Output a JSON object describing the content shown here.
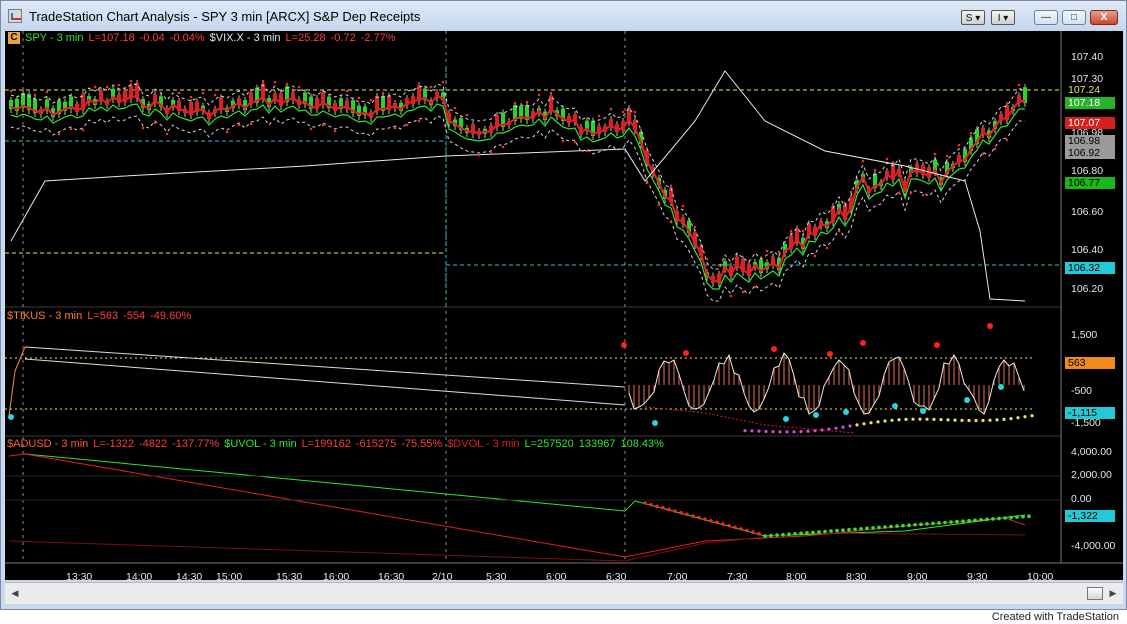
{
  "window": {
    "title": "TradeStation Chart Analysis - SPY 3 min [ARCX] S&P Dep Receipts"
  },
  "toolbar": {
    "s_button": "S",
    "i_button": "I"
  },
  "caption": {
    "minimize": "—",
    "maximize": "□",
    "close": "X"
  },
  "panes": {
    "price": {
      "badge": "C",
      "legend": [
        {
          "text": "SPY - 3 min",
          "color": "#2ee62e"
        },
        {
          "text": "L=107.18",
          "color": "#ff3b3b"
        },
        {
          "text": "-0.04",
          "color": "#ff3b3b"
        },
        {
          "text": "-0.04%",
          "color": "#ff3b3b"
        },
        {
          "text": "$VIX.X - 3 min",
          "color": "#e6e6e6"
        },
        {
          "text": "L=25.28",
          "color": "#ff3b3b"
        },
        {
          "text": "-0.72",
          "color": "#ff3b3b"
        },
        {
          "text": "-2.77%",
          "color": "#ff3b3b"
        }
      ],
      "axis": [
        "107.40",
        "107.30",
        "107.24",
        "107.18",
        "107.07",
        "106.98",
        "106.92",
        "106.80",
        "106.77",
        "106.60",
        "106.40",
        "106.32",
        "106.20"
      ],
      "tags": {
        "t10724": {
          "text": "107.24",
          "bg": "#000000",
          "fg": "#f0e44c"
        },
        "t10718": {
          "text": "107.18",
          "bg": "#27b327",
          "fg": "#ffffff"
        },
        "t10707": {
          "text": "107.07",
          "bg": "#d81f1f",
          "fg": "#ffffff"
        },
        "t10698": {
          "text": "106.98",
          "bg": "#9a9a9a",
          "fg": "#000000"
        },
        "t10692": {
          "text": "106.92",
          "bg": "#9a9a9a",
          "fg": "#000000"
        },
        "t10677": {
          "text": "106.77",
          "bg": "#18b818",
          "fg": "#000000"
        },
        "t10632": {
          "text": "106.32",
          "bg": "#24c9d6",
          "fg": "#000000"
        }
      }
    },
    "tikus": {
      "legend": [
        {
          "text": "$TIKUS - 3 min",
          "color": "#ff7b2a"
        },
        {
          "text": "L=563",
          "color": "#ff3b3b"
        },
        {
          "text": "-554",
          "color": "#ff3b3b"
        },
        {
          "text": "-49.60%",
          "color": "#ff3b3b"
        }
      ],
      "axis": [
        "1,500",
        "-500",
        "-1,500"
      ],
      "tags": {
        "t563": {
          "text": "563",
          "bg": "#f08a1c",
          "fg": "#000000"
        },
        "t1115": {
          "text": "-1,115",
          "bg": "#24c9d6",
          "fg": "#000000"
        }
      }
    },
    "adusd": {
      "legend": [
        {
          "text": "$ADUSD - 3 min",
          "color": "#ff5a2a"
        },
        {
          "text": "L=-1322",
          "color": "#ff3b3b"
        },
        {
          "text": "-4822",
          "color": "#ff3b3b"
        },
        {
          "text": "-137.77%",
          "color": "#ff3b3b"
        },
        {
          "text": "$UVOL - 3 min",
          "color": "#2ee62e"
        },
        {
          "text": "L=199162",
          "color": "#ff3b3b"
        },
        {
          "text": "-615275",
          "color": "#ff3b3b"
        },
        {
          "text": "-75.55%",
          "color": "#ff3b3b"
        },
        {
          "text": "$DVOL - 3 min",
          "color": "#d81f1f"
        },
        {
          "text": "L=257520",
          "color": "#2ee62e"
        },
        {
          "text": "133967",
          "color": "#2ee62e"
        },
        {
          "text": "108.43%",
          "color": "#2ee62e"
        }
      ],
      "axis": [
        "4,000.00",
        "2,000.00",
        "0.00",
        "-4,000.00"
      ],
      "tags": {
        "t1322": {
          "text": "-1,322",
          "bg": "#24c9d6",
          "fg": "#000000"
        }
      }
    }
  },
  "x_axis": [
    "13:30",
    "14:00",
    "14:30",
    "15:00",
    "15:30",
    "16:00",
    "16:30",
    "2/10",
    "5:30",
    "6:00",
    "6:30",
    "7:00",
    "7:30",
    "8:00",
    "8:30",
    "9:00",
    "9:30",
    "10:00"
  ],
  "scroll": {
    "left_arrow": "◀",
    "right_arrow": "▶"
  },
  "footer": {
    "credit": "Created with TradeStation"
  }
}
